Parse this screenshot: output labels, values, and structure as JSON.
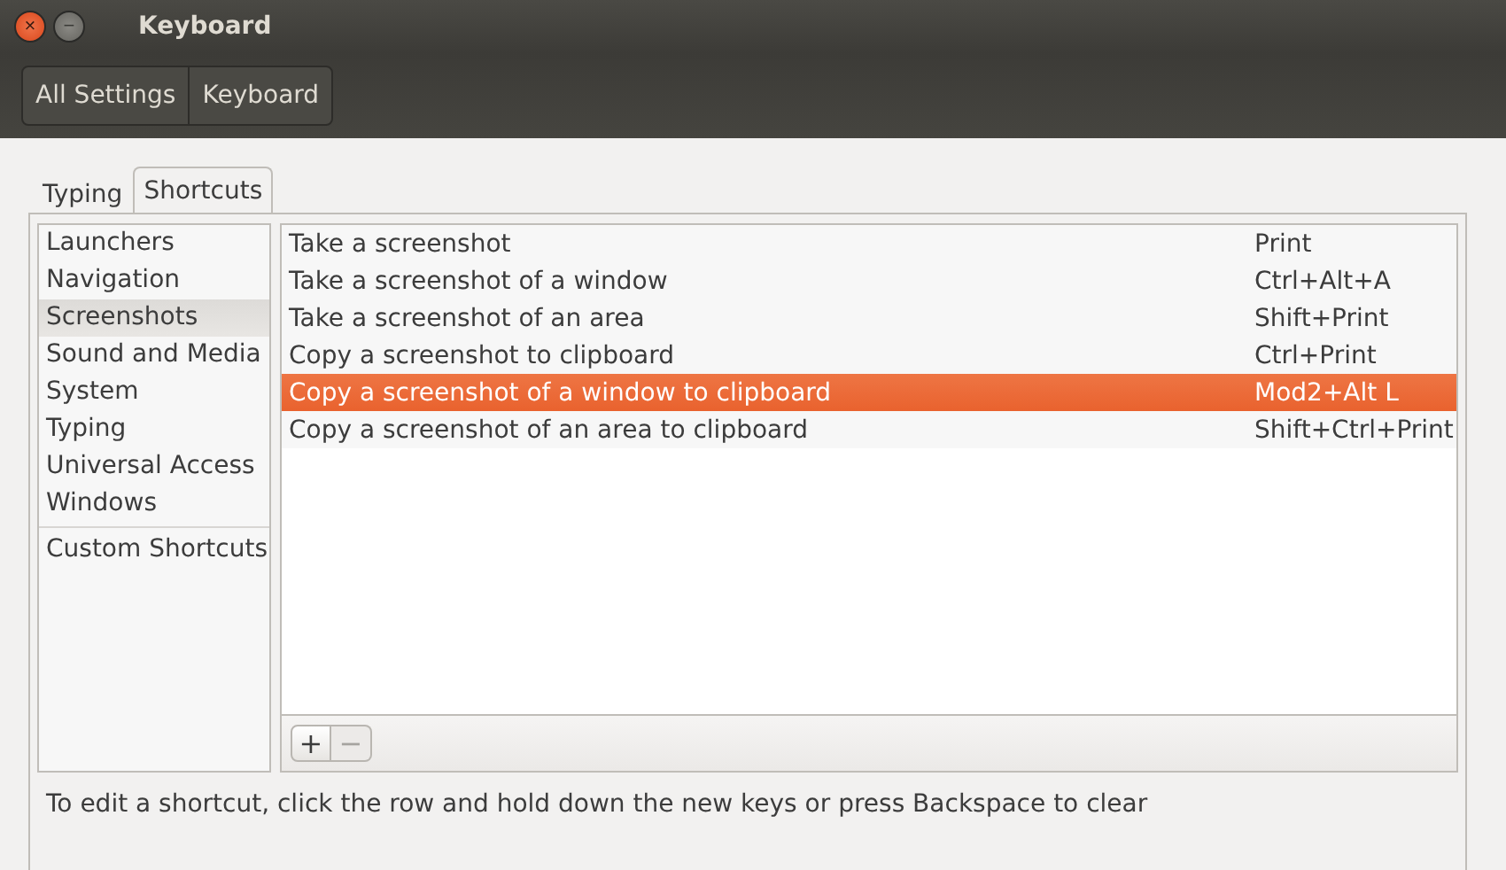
{
  "window": {
    "title": "Keyboard",
    "close": "×",
    "minimize": "−"
  },
  "breadcrumb": [
    {
      "label": "All Settings"
    },
    {
      "label": "Keyboard"
    }
  ],
  "tabs": [
    {
      "label": "Typing",
      "selected": false
    },
    {
      "label": "Shortcuts",
      "selected": true
    }
  ],
  "categories": [
    {
      "label": "Launchers",
      "selected": false
    },
    {
      "label": "Navigation",
      "selected": false
    },
    {
      "label": "Screenshots",
      "selected": true
    },
    {
      "label": "Sound and Media",
      "selected": false
    },
    {
      "label": "System",
      "selected": false
    },
    {
      "label": "Typing",
      "selected": false
    },
    {
      "label": "Universal Access",
      "selected": false
    },
    {
      "label": "Windows",
      "selected": false
    }
  ],
  "custom_category": {
    "label": "Custom Shortcuts",
    "selected": false
  },
  "shortcuts": [
    {
      "action": "Take a screenshot",
      "keys": "Print",
      "selected": false
    },
    {
      "action": "Take a screenshot of a window",
      "keys": "Ctrl+Alt+A",
      "selected": false
    },
    {
      "action": "Take a screenshot of an area",
      "keys": "Shift+Print",
      "selected": false
    },
    {
      "action": "Copy a screenshot to clipboard",
      "keys": "Ctrl+Print",
      "selected": false
    },
    {
      "action": "Copy a screenshot of a window to clipboard",
      "keys": "Mod2+Alt L",
      "selected": true
    },
    {
      "action": "Copy a screenshot of an area to clipboard",
      "keys": "Shift+Ctrl+Print",
      "selected": false
    }
  ],
  "list_buttons": [
    {
      "label": "+",
      "disabled": false
    },
    {
      "label": "−",
      "disabled": true
    }
  ],
  "hint": "To edit a shortcut, click the row and hold down the new keys or press Backspace to clear"
}
